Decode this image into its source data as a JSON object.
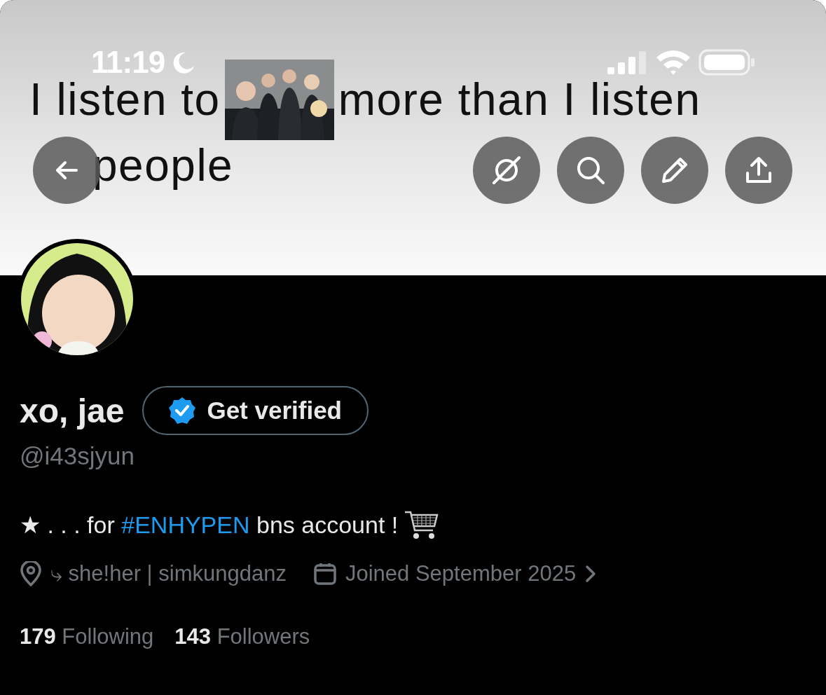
{
  "status_bar": {
    "time": "11:19"
  },
  "banner": {
    "line_1_start": "I listen to",
    "line_1_end": "more than I listen",
    "line_2": "people"
  },
  "profile": {
    "name": "xo, jae",
    "verify_button": "Get verified",
    "handle": "@i43sjyun",
    "bio": [
      {
        "kind": "plain",
        "text": "★ . . . for "
      },
      {
        "kind": "hashtag",
        "text": "#ENHYPEN"
      },
      {
        "kind": "plain",
        "text": " bns account !"
      }
    ],
    "location": "⤷ she!her | simkungdanz",
    "joined": "Joined September 2025",
    "stats": [
      {
        "count": "179",
        "label": "Following"
      },
      {
        "count": "143",
        "label": "Followers"
      }
    ]
  }
}
